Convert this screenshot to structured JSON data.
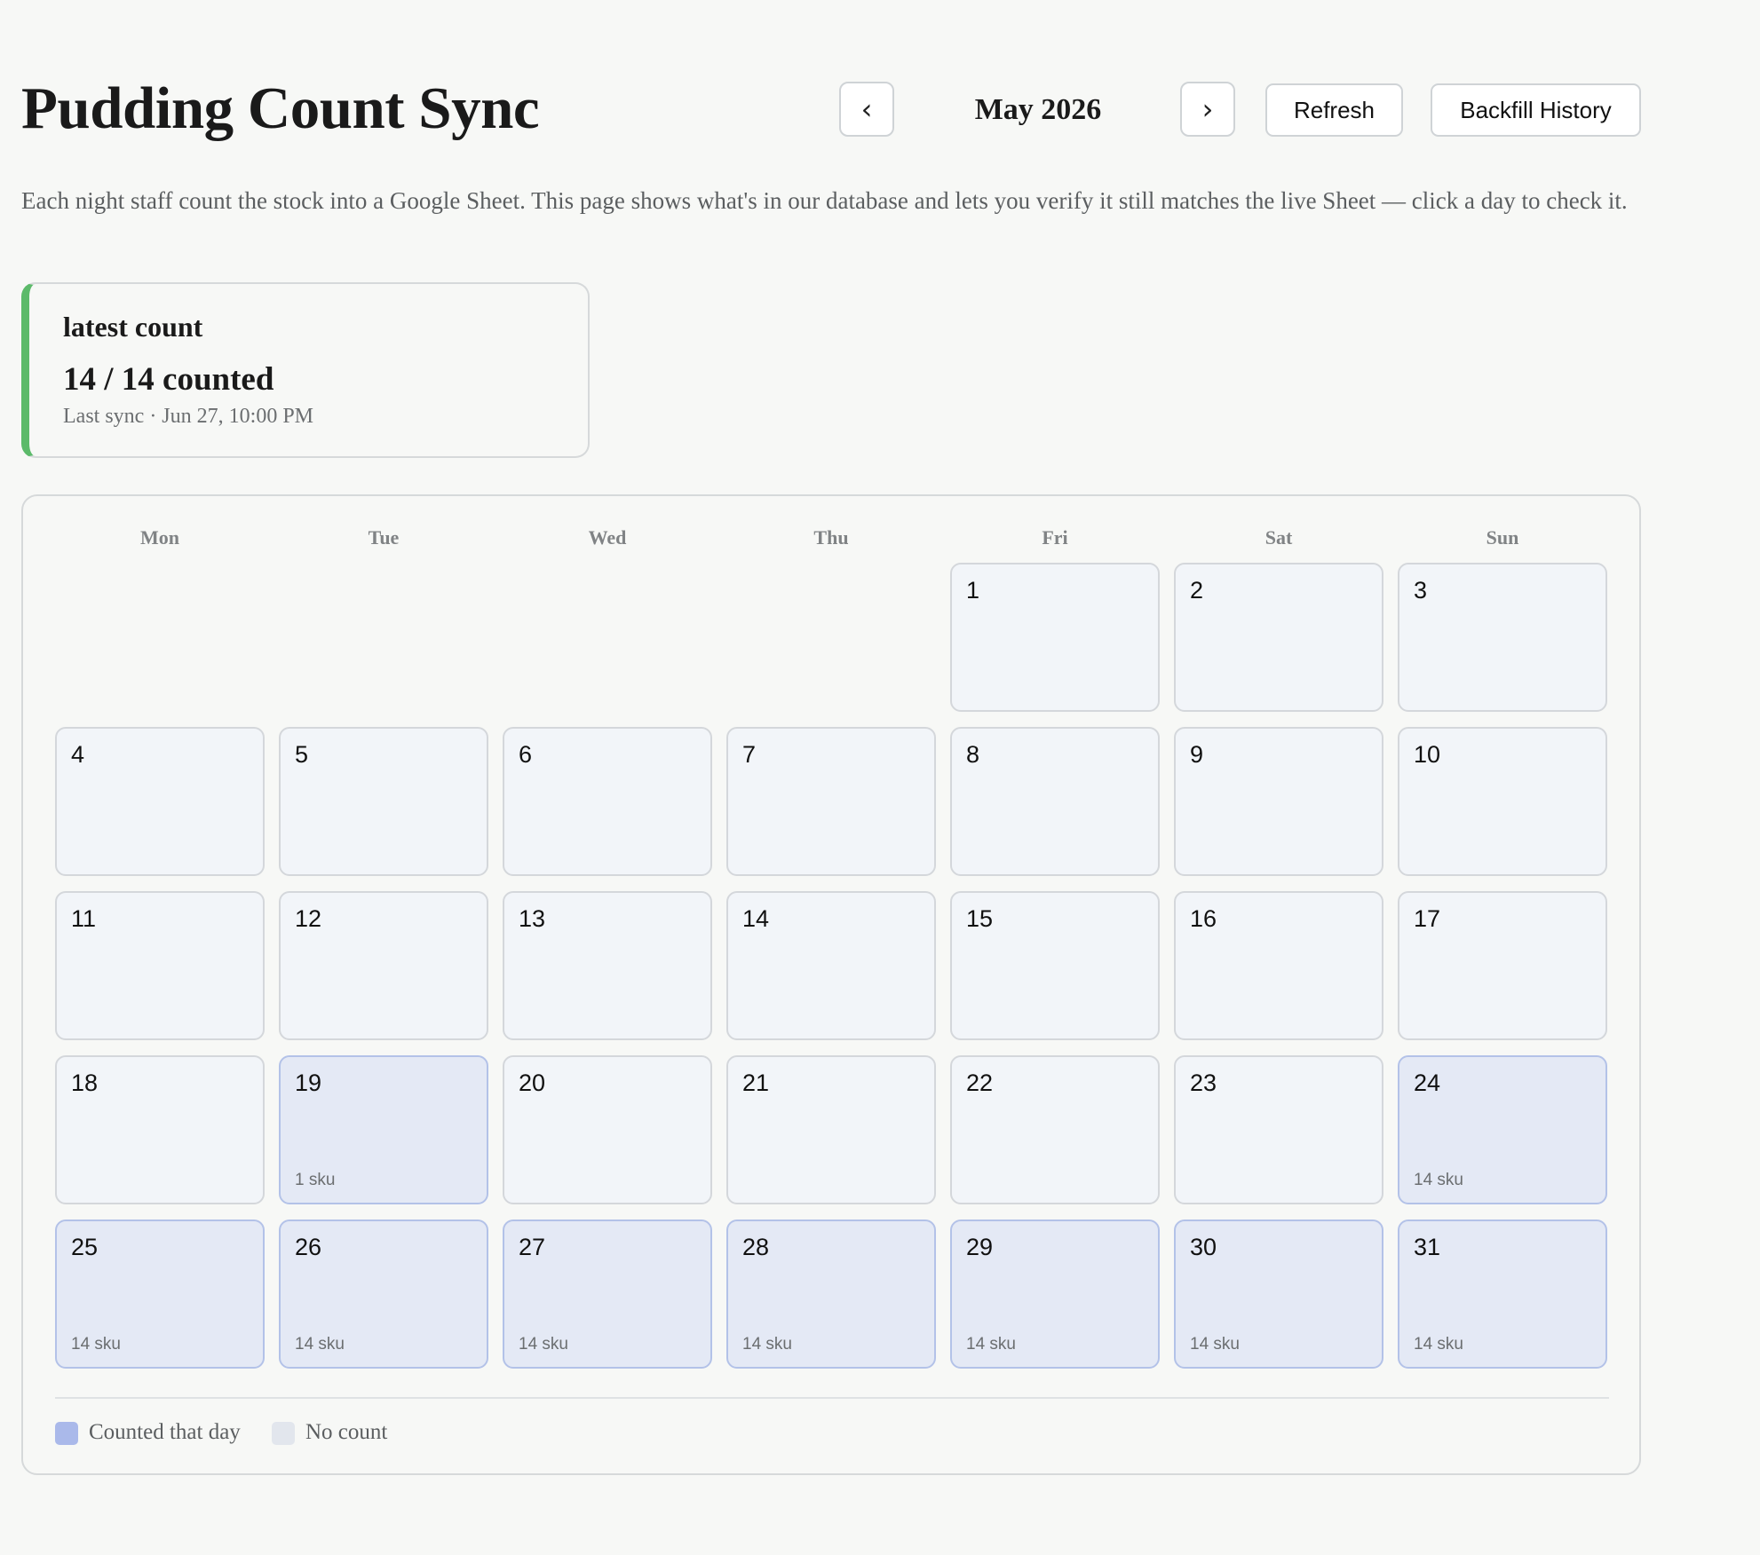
{
  "header": {
    "title": "Pudding Count Sync",
    "prev_icon": "‹",
    "month": "May 2026",
    "next_icon": "›",
    "refresh_label": "Refresh",
    "backfill_label": "Backfill History"
  },
  "intro": "Each night staff count the stock into a Google Sheet. This page shows what's in our database and lets you verify it still matches the live Sheet — click a day to check it.",
  "latest": {
    "heading": "latest count",
    "value": "14 / 14 counted",
    "sync": "Last sync · Jun 27, 10:00 PM",
    "accent_color": "#5cba6a"
  },
  "calendar": {
    "weekdays": [
      "Mon",
      "Tue",
      "Wed",
      "Thu",
      "Fri",
      "Sat",
      "Sun"
    ],
    "first_weekday_index": 4,
    "days": [
      {
        "day": "1",
        "sku": ""
      },
      {
        "day": "2",
        "sku": ""
      },
      {
        "day": "3",
        "sku": ""
      },
      {
        "day": "4",
        "sku": ""
      },
      {
        "day": "5",
        "sku": ""
      },
      {
        "day": "6",
        "sku": ""
      },
      {
        "day": "7",
        "sku": ""
      },
      {
        "day": "8",
        "sku": ""
      },
      {
        "day": "9",
        "sku": ""
      },
      {
        "day": "10",
        "sku": ""
      },
      {
        "day": "11",
        "sku": ""
      },
      {
        "day": "12",
        "sku": ""
      },
      {
        "day": "13",
        "sku": ""
      },
      {
        "day": "14",
        "sku": ""
      },
      {
        "day": "15",
        "sku": ""
      },
      {
        "day": "16",
        "sku": ""
      },
      {
        "day": "17",
        "sku": ""
      },
      {
        "day": "18",
        "sku": ""
      },
      {
        "day": "19",
        "sku": "1 sku"
      },
      {
        "day": "20",
        "sku": ""
      },
      {
        "day": "21",
        "sku": ""
      },
      {
        "day": "22",
        "sku": ""
      },
      {
        "day": "23",
        "sku": ""
      },
      {
        "day": "24",
        "sku": "14 sku"
      },
      {
        "day": "25",
        "sku": "14 sku"
      },
      {
        "day": "26",
        "sku": "14 sku"
      },
      {
        "day": "27",
        "sku": "14 sku"
      },
      {
        "day": "28",
        "sku": "14 sku"
      },
      {
        "day": "29",
        "sku": "14 sku"
      },
      {
        "day": "30",
        "sku": "14 sku"
      },
      {
        "day": "31",
        "sku": "14 sku"
      }
    ]
  },
  "legend": {
    "counted_label": "Counted that day",
    "counted_color": "#aab9ea",
    "none_label": "No count",
    "none_color": "#e2e6ed"
  }
}
